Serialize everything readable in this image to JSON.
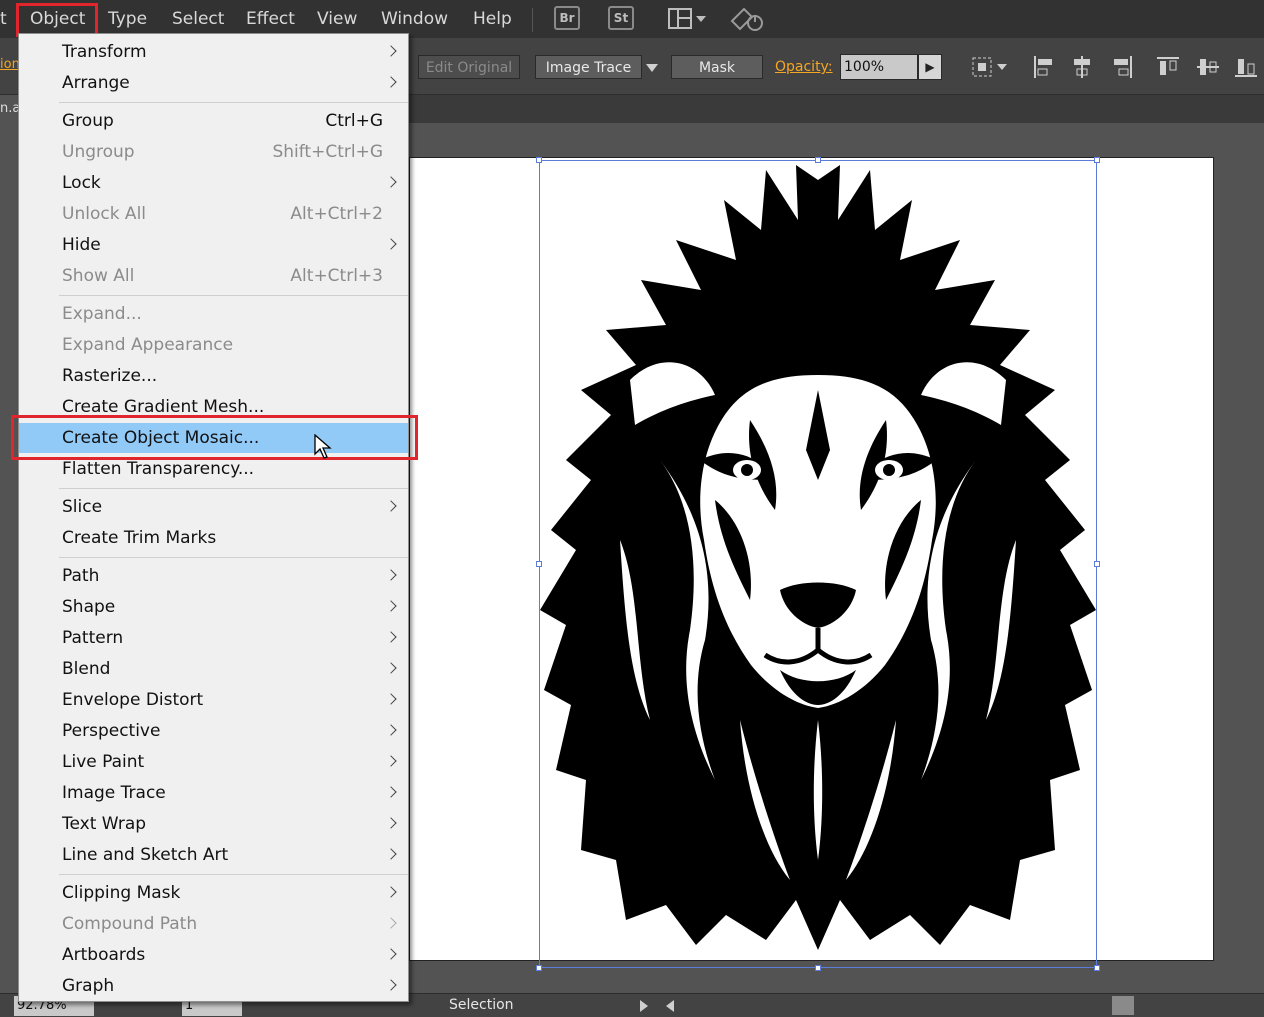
{
  "menubar": {
    "items": [
      "t",
      "Object",
      "Type",
      "Select",
      "Effect",
      "View",
      "Window",
      "Help"
    ],
    "badges": [
      "Br",
      "St"
    ]
  },
  "controlbar": {
    "left_fragment": "ion",
    "edit_original": "Edit Original",
    "image_trace": "Image Trace",
    "mask": "Mask",
    "opacity_label": "Opacity:",
    "opacity_value": "100%"
  },
  "tabrow": {
    "doc_tab_fragment": "n.a"
  },
  "menu": {
    "items": [
      {
        "label": "Transform",
        "shortcut": "",
        "submenu": true,
        "enabled": true
      },
      {
        "label": "Arrange",
        "shortcut": "",
        "submenu": true,
        "enabled": true
      },
      {
        "label": "Group",
        "shortcut": "Ctrl+G",
        "submenu": false,
        "enabled": true
      },
      {
        "label": "Ungroup",
        "shortcut": "Shift+Ctrl+G",
        "submenu": false,
        "enabled": false
      },
      {
        "label": "Lock",
        "shortcut": "",
        "submenu": true,
        "enabled": true
      },
      {
        "label": "Unlock All",
        "shortcut": "Alt+Ctrl+2",
        "submenu": false,
        "enabled": false
      },
      {
        "label": "Hide",
        "shortcut": "",
        "submenu": true,
        "enabled": true
      },
      {
        "label": "Show All",
        "shortcut": "Alt+Ctrl+3",
        "submenu": false,
        "enabled": false
      },
      {
        "label": "Expand...",
        "shortcut": "",
        "submenu": false,
        "enabled": false
      },
      {
        "label": "Expand Appearance",
        "shortcut": "",
        "submenu": false,
        "enabled": false
      },
      {
        "label": "Rasterize...",
        "shortcut": "",
        "submenu": false,
        "enabled": true
      },
      {
        "label": "Create Gradient Mesh...",
        "shortcut": "",
        "submenu": false,
        "enabled": true
      },
      {
        "label": "Create Object Mosaic...",
        "shortcut": "",
        "submenu": false,
        "enabled": true,
        "highlighted": true
      },
      {
        "label": "Flatten Transparency...",
        "shortcut": "",
        "submenu": false,
        "enabled": true
      },
      {
        "label": "Slice",
        "shortcut": "",
        "submenu": true,
        "enabled": true
      },
      {
        "label": "Create Trim Marks",
        "shortcut": "",
        "submenu": false,
        "enabled": true
      },
      {
        "label": "Path",
        "shortcut": "",
        "submenu": true,
        "enabled": true
      },
      {
        "label": "Shape",
        "shortcut": "",
        "submenu": true,
        "enabled": true
      },
      {
        "label": "Pattern",
        "shortcut": "",
        "submenu": true,
        "enabled": true
      },
      {
        "label": "Blend",
        "shortcut": "",
        "submenu": true,
        "enabled": true
      },
      {
        "label": "Envelope Distort",
        "shortcut": "",
        "submenu": true,
        "enabled": true
      },
      {
        "label": "Perspective",
        "shortcut": "",
        "submenu": true,
        "enabled": true
      },
      {
        "label": "Live Paint",
        "shortcut": "",
        "submenu": true,
        "enabled": true
      },
      {
        "label": "Image Trace",
        "shortcut": "",
        "submenu": true,
        "enabled": true
      },
      {
        "label": "Text Wrap",
        "shortcut": "",
        "submenu": true,
        "enabled": true
      },
      {
        "label": "Line and Sketch Art",
        "shortcut": "",
        "submenu": true,
        "enabled": true
      },
      {
        "label": "Clipping Mask",
        "shortcut": "",
        "submenu": true,
        "enabled": true
      },
      {
        "label": "Compound Path",
        "shortcut": "",
        "submenu": true,
        "enabled": false
      },
      {
        "label": "Artboards",
        "shortcut": "",
        "submenu": true,
        "enabled": true
      },
      {
        "label": "Graph",
        "shortcut": "",
        "submenu": true,
        "enabled": true
      }
    ]
  },
  "statusbar": {
    "zoom": "92.78%",
    "page": "1",
    "tool": "Selection"
  },
  "colors": {
    "highlight_frame": "#e0262c",
    "menu_highlight": "#91c9f7",
    "selection_bounds": "#5b7cd8",
    "opacity_label": "#f5a623"
  }
}
